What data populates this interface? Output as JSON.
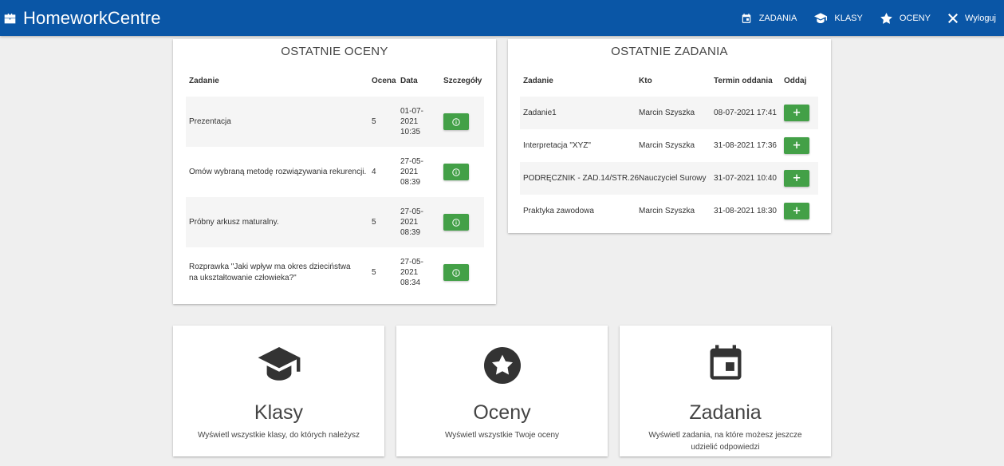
{
  "navbar": {
    "brand": "HomeworkCentre",
    "items": [
      {
        "label": "ZADANIA",
        "icon": "calendar-icon"
      },
      {
        "label": "KLASY",
        "icon": "graduation-cap-icon"
      },
      {
        "label": "OCENY",
        "icon": "star-icon"
      },
      {
        "label": "Wyloguj",
        "icon": "close-icon"
      }
    ],
    "background": "#0a56a6"
  },
  "grades": {
    "title": "OSTATNIE OCENY",
    "headers": [
      "Zadanie",
      "Ocena",
      "Data",
      "Szczegóły"
    ],
    "rows": [
      {
        "task": "Prezentacja",
        "grade": "5",
        "date": [
          "01-07-",
          "2021",
          "10:35"
        ]
      },
      {
        "task": "Omów wybraną metodę rozwiązywania rekurencji.",
        "grade": "4",
        "date": [
          "27-05-",
          "2021",
          "08:39"
        ]
      },
      {
        "task": "Próbny arkusz maturalny.",
        "grade": "5",
        "date": [
          "27-05-",
          "2021",
          "08:39"
        ]
      },
      {
        "task": "Rozprawka \"Jaki wpływ ma okres dzieciństwa na ukształtowanie człowieka?\"",
        "grade": "5",
        "date": [
          "27-05-",
          "2021",
          "08:34"
        ]
      }
    ]
  },
  "tasks": {
    "title": "OSTATNIE ZADANIA",
    "headers": [
      "Zadanie",
      "Kto",
      "Termin oddania",
      "Oddaj"
    ],
    "rows": [
      {
        "task": "Zadanie1",
        "who": "Marcin Szyszka",
        "deadline": "08-07-2021 17:41"
      },
      {
        "task": "Interpretacja \"XYZ\"",
        "who": "Marcin Szyszka",
        "deadline": "31-08-2021 17:36"
      },
      {
        "task": "PODRĘCZNIK - ZAD.14/STR.26",
        "who": "Nauczyciel Surowy",
        "deadline": "31-07-2021 10:40"
      },
      {
        "task": "Praktyka zawodowa",
        "who": "Marcin Szyszka",
        "deadline": "31-08-2021 18:30"
      }
    ],
    "button_label": "+"
  },
  "tiles": [
    {
      "title": "Klasy",
      "desc": "Wyświetl wszystkie klasy, do których należysz",
      "icon": "graduation-cap-icon"
    },
    {
      "title": "Oceny",
      "desc": "Wyświetl wszystkie Twoje oceny",
      "icon": "star-circle-icon"
    },
    {
      "title": "Zadania",
      "desc": "Wyświetl zadania, na które możesz jeszcze udzielić odpowiedzi",
      "icon": "calendar-icon"
    }
  ],
  "colors": {
    "accent_green": "#43a047",
    "page_bg": "#efefef"
  }
}
